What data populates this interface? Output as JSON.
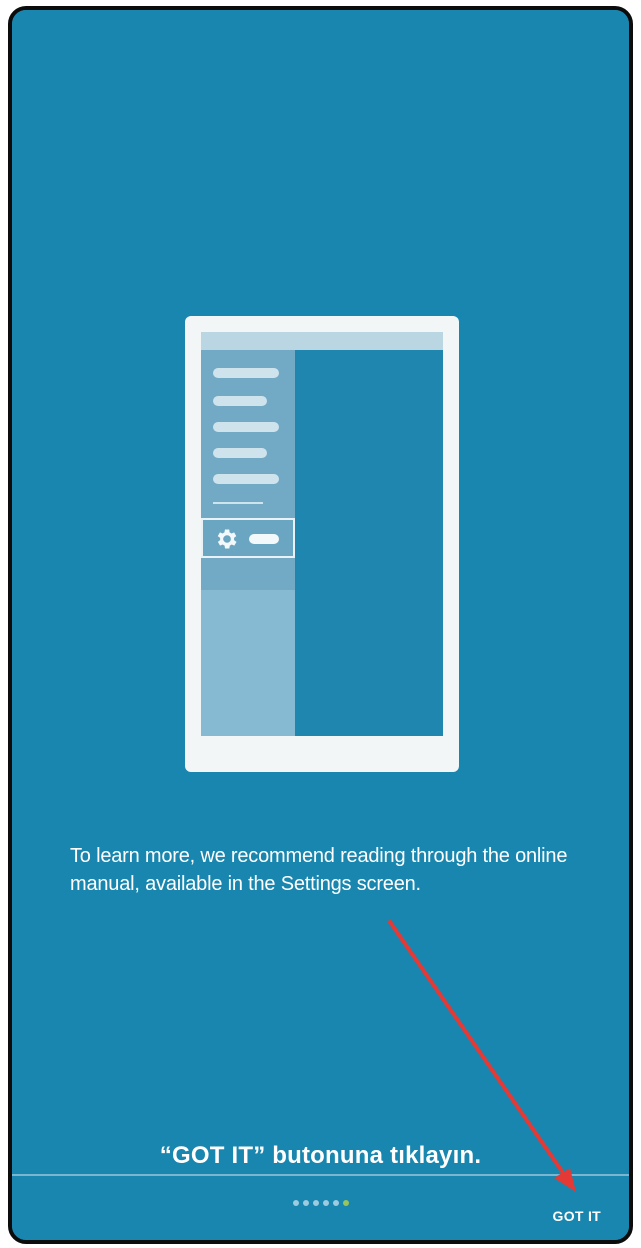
{
  "onboarding": {
    "body_text": "To learn more, we recommend reading through the online manual, available in the Settings screen.",
    "instruction_text": "“GOT IT” butonuna tıklayın.",
    "got_it_label": "GOT IT",
    "page_indicator": {
      "total": 6,
      "current": 6
    }
  },
  "colors": {
    "background": "#1886ae",
    "active_dot": "#9bc45a",
    "annotation_arrow": "#e53935"
  },
  "icons": {
    "settings": "gear-icon"
  }
}
